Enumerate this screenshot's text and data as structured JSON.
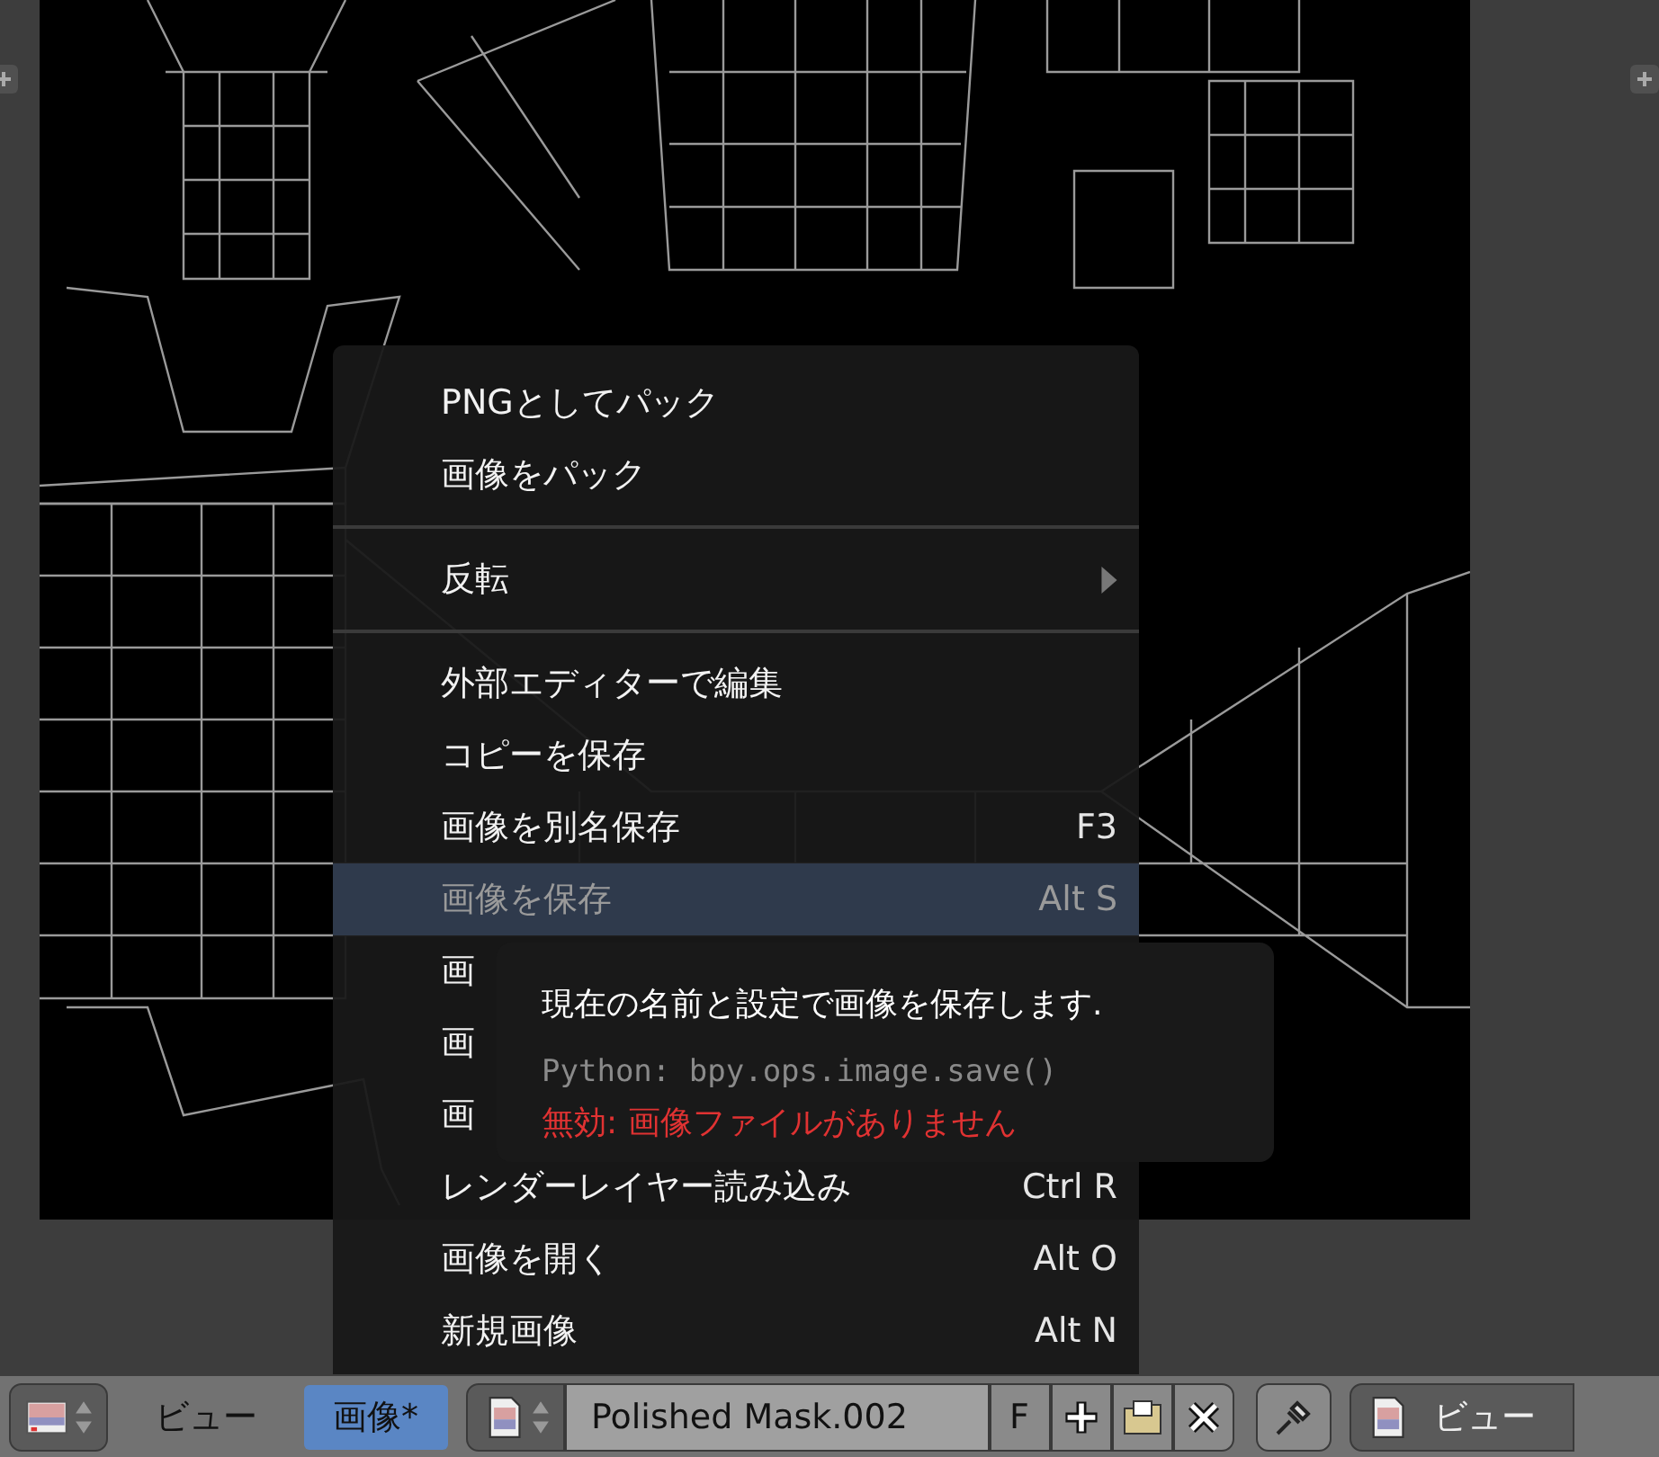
{
  "menu": {
    "items": [
      {
        "kind": "item",
        "label": "PNGとしてパック",
        "selected": false,
        "disabled": false
      },
      {
        "kind": "item",
        "label": "画像をパック",
        "selected": false,
        "disabled": false
      },
      {
        "kind": "separator"
      },
      {
        "kind": "submenu",
        "label": "反転",
        "selected": false,
        "disabled": false
      },
      {
        "kind": "separator"
      },
      {
        "kind": "item",
        "label": "外部エディターで編集",
        "selected": false,
        "disabled": false
      },
      {
        "kind": "item",
        "label": "コピーを保存",
        "selected": false,
        "disabled": false
      },
      {
        "kind": "item",
        "label": "画像を別名保存",
        "shortcut": "F3",
        "selected": false,
        "disabled": false
      },
      {
        "kind": "item",
        "label": "画像を保存",
        "shortcut": "Alt S",
        "selected": true,
        "disabled": true
      },
      {
        "kind": "item",
        "label": "画",
        "selected": false,
        "disabled": false
      },
      {
        "kind": "item",
        "label": "画",
        "selected": false,
        "disabled": false
      },
      {
        "kind": "item",
        "label": "画",
        "selected": false,
        "disabled": false
      },
      {
        "kind": "item",
        "label": "レンダーレイヤー読み込み",
        "shortcut": "Ctrl R",
        "selected": false,
        "disabled": false
      },
      {
        "kind": "item",
        "label": "画像を開く",
        "shortcut": "Alt O",
        "selected": false,
        "disabled": false
      },
      {
        "kind": "item",
        "label": "新規画像",
        "shortcut": "Alt N",
        "selected": false,
        "disabled": false
      }
    ]
  },
  "tooltip": {
    "description": "現在の名前と設定で画像を保存します.",
    "python": "Python: bpy.ops.image.save()",
    "error": "無効: 画像ファイルがありません"
  },
  "header": {
    "menus": [
      {
        "label": "ビュー",
        "selected": false
      },
      {
        "label": "画像*",
        "selected": true
      }
    ],
    "image": {
      "name": "Polished Mask.002",
      "fake_user": "F"
    },
    "view_button": {
      "label": "ビュー"
    }
  }
}
